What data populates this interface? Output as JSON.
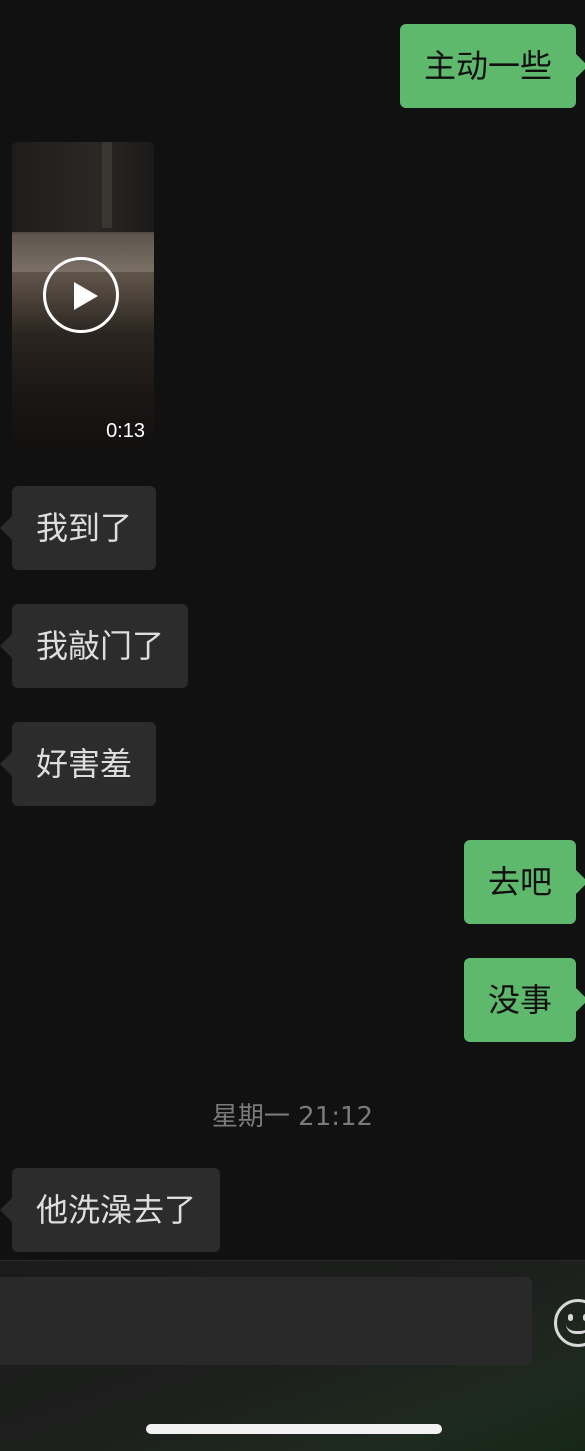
{
  "messages": [
    {
      "side": "out",
      "text": "主动一些"
    },
    {
      "side": "in",
      "type": "video",
      "duration": "0:13"
    },
    {
      "side": "in",
      "text": "我到了"
    },
    {
      "side": "in",
      "text": "我敲门了"
    },
    {
      "side": "in",
      "text": "好害羞"
    },
    {
      "side": "out",
      "text": "去吧"
    },
    {
      "side": "out",
      "text": "没事"
    },
    {
      "side": "in",
      "text": "他洗澡去了"
    }
  ],
  "timestamp": "星期一 21:12",
  "input_bar": {
    "emoji_icon": "smiley-face-icon"
  },
  "colors": {
    "background": "#111111",
    "outgoing_bubble": "#5fb96c",
    "incoming_bubble": "#2c2c2c",
    "timestamp_text": "#7a7a7a"
  }
}
